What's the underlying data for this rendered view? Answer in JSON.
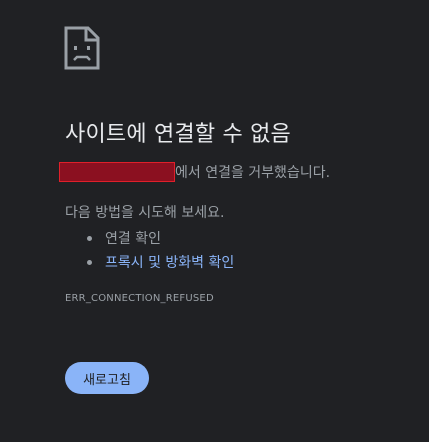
{
  "error_page": {
    "icon": "sad-page-icon",
    "title": "사이트에 연결할 수 없음",
    "refused_text": "에서 연결을 거부했습니다.",
    "try_heading": "다음 방법을 시도해 보세요.",
    "suggestions": [
      {
        "label": "연결 확인",
        "link": false
      },
      {
        "label": "프록시 및 방화벽 확인",
        "link": true
      }
    ],
    "error_code": "ERR_CONNECTION_REFUSED",
    "reload_label": "새로고침"
  },
  "colors": {
    "background": "#202124",
    "title": "#e8eaed",
    "body_text": "#9aa0a6",
    "link": "#8ab4f8",
    "button": "#8ab4f8",
    "redaction_fill": "#8b1020",
    "redaction_border": "#e0202a"
  }
}
